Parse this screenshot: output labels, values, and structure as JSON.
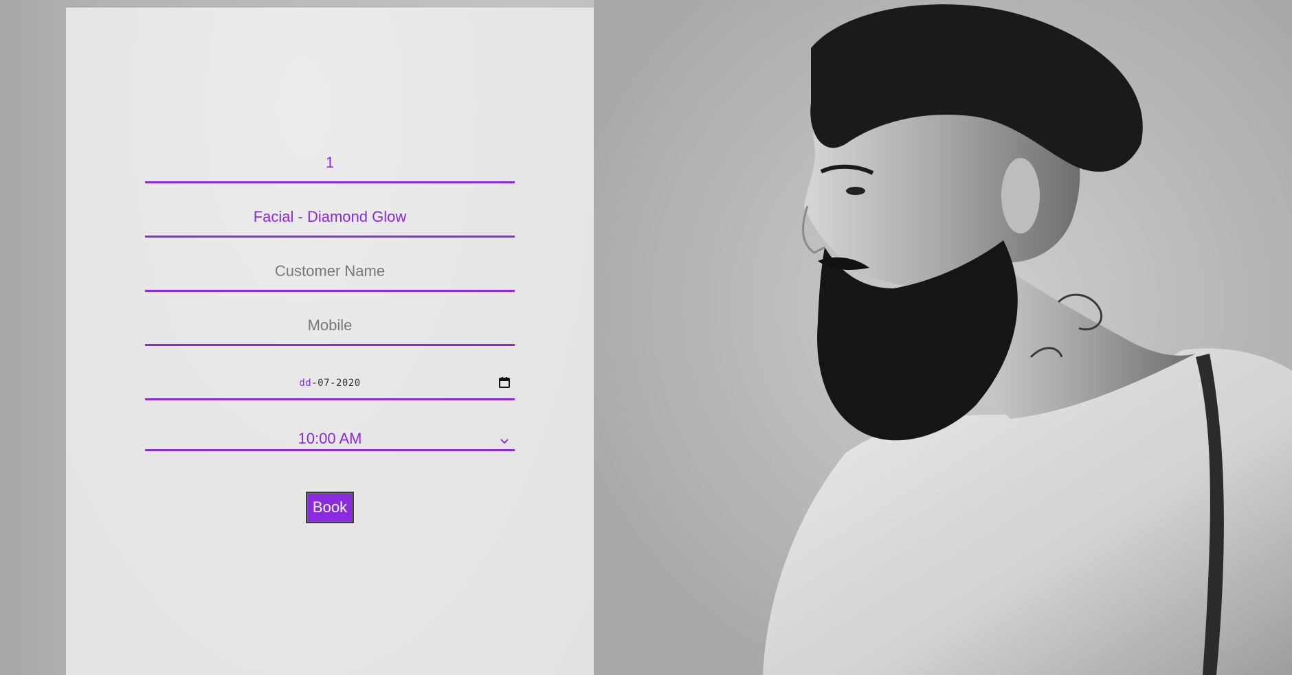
{
  "form": {
    "quantity": {
      "value": "1"
    },
    "service": {
      "value": "Facial - Diamond Glow"
    },
    "customer_name": {
      "placeholder": "Customer Name"
    },
    "mobile": {
      "placeholder": "Mobile"
    },
    "date": {
      "day_placeholder": "dd",
      "separator": "-",
      "month": "07",
      "year": "2020"
    },
    "time": {
      "selected": "10:00 AM"
    },
    "book_label": "Book"
  },
  "icons": {
    "date_picker": "calendar-icon",
    "time_dropdown": "chevron-down-icon"
  },
  "colors": {
    "accent": "#8a2be2",
    "placeholder": "#777777",
    "panel": "#e6e6e7"
  }
}
